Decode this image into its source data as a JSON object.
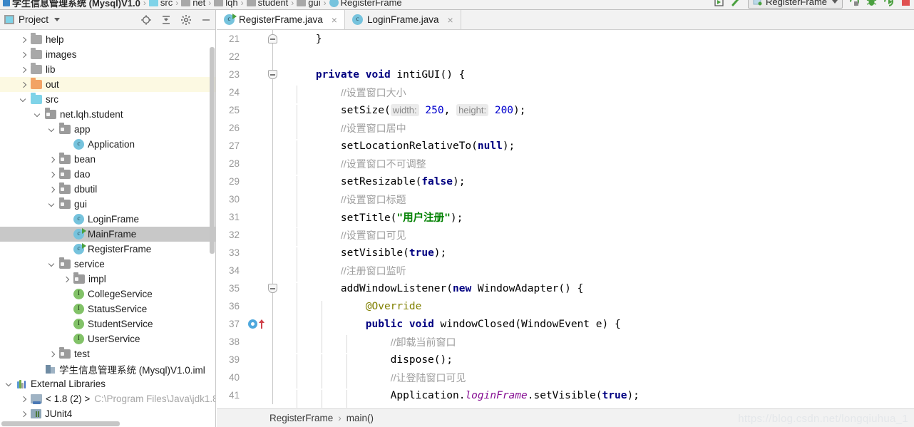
{
  "breadcrumb_top": {
    "items": [
      {
        "label": "学生信息管理系统 (Mysql)V1.0",
        "icon": "project-square-icon"
      },
      {
        "label": "src",
        "icon": "folder-blue-icon"
      },
      {
        "label": "net",
        "icon": "folder-icon"
      },
      {
        "label": "lqh",
        "icon": "folder-icon"
      },
      {
        "label": "student",
        "icon": "folder-icon"
      },
      {
        "label": "gui",
        "icon": "folder-icon"
      },
      {
        "label": "RegisterFrame",
        "icon": "class-icon"
      }
    ],
    "separator": "›"
  },
  "toolbar": {
    "run_config_label": "RegisterFrame",
    "buttons": [
      "project-structure-icon",
      "search-icon",
      "run-config-selector",
      "run-with-coverage-icon",
      "debug-icon",
      "run-icon",
      "stop-icon"
    ]
  },
  "project_panel": {
    "title": "Project",
    "tools": [
      "locate-icon",
      "collapse-all-icon",
      "settings-gear-icon",
      "hide-icon"
    ],
    "tree": [
      {
        "indent": 1,
        "arrow": "right",
        "icon": "folder",
        "label": "help",
        "state": ""
      },
      {
        "indent": 1,
        "arrow": "right",
        "icon": "folder",
        "label": "images",
        "state": ""
      },
      {
        "indent": 1,
        "arrow": "right",
        "icon": "folder",
        "label": "lib",
        "state": ""
      },
      {
        "indent": 1,
        "arrow": "right",
        "icon": "folder-orange",
        "label": "out",
        "state": "highlight"
      },
      {
        "indent": 1,
        "arrow": "down",
        "icon": "folder-blue",
        "label": "src",
        "state": ""
      },
      {
        "indent": 2,
        "arrow": "down",
        "icon": "package",
        "label": "net.lqh.student",
        "state": ""
      },
      {
        "indent": 3,
        "arrow": "down",
        "icon": "package",
        "label": "app",
        "state": ""
      },
      {
        "indent": 4,
        "arrow": "none",
        "icon": "class",
        "label": "Application",
        "state": ""
      },
      {
        "indent": 3,
        "arrow": "right",
        "icon": "package",
        "label": "bean",
        "state": ""
      },
      {
        "indent": 3,
        "arrow": "right",
        "icon": "package",
        "label": "dao",
        "state": ""
      },
      {
        "indent": 3,
        "arrow": "right",
        "icon": "package",
        "label": "dbutil",
        "state": ""
      },
      {
        "indent": 3,
        "arrow": "down",
        "icon": "package",
        "label": "gui",
        "state": ""
      },
      {
        "indent": 4,
        "arrow": "none",
        "icon": "class",
        "label": "LoginFrame",
        "state": ""
      },
      {
        "indent": 4,
        "arrow": "none",
        "icon": "class-runnable",
        "label": "MainFrame",
        "state": "selected"
      },
      {
        "indent": 4,
        "arrow": "none",
        "icon": "class-runnable",
        "label": "RegisterFrame",
        "state": ""
      },
      {
        "indent": 3,
        "arrow": "down",
        "icon": "package",
        "label": "service",
        "state": ""
      },
      {
        "indent": 4,
        "arrow": "right",
        "icon": "package",
        "label": "impl",
        "state": ""
      },
      {
        "indent": 4,
        "arrow": "none",
        "icon": "interface",
        "label": "CollegeService",
        "state": ""
      },
      {
        "indent": 4,
        "arrow": "none",
        "icon": "interface",
        "label": "StatusService",
        "state": ""
      },
      {
        "indent": 4,
        "arrow": "none",
        "icon": "interface",
        "label": "StudentService",
        "state": ""
      },
      {
        "indent": 4,
        "arrow": "none",
        "icon": "interface",
        "label": "UserService",
        "state": ""
      },
      {
        "indent": 3,
        "arrow": "right",
        "icon": "package",
        "label": "test",
        "state": ""
      },
      {
        "indent": 2,
        "arrow": "none",
        "icon": "iml",
        "label": "学生信息管理系统 (Mysql)V1.0.iml",
        "state": ""
      },
      {
        "indent": 0,
        "arrow": "down",
        "icon": "libraries",
        "label": "External Libraries",
        "state": ""
      },
      {
        "indent": 1,
        "arrow": "right",
        "icon": "sdk",
        "label": "< 1.8 (2) >",
        "path": "C:\\Program Files\\Java\\jdk1.8.",
        "state": ""
      },
      {
        "indent": 1,
        "arrow": "right",
        "icon": "jar",
        "label": "JUnit4",
        "state": ""
      }
    ]
  },
  "editor": {
    "tabs": [
      {
        "label": "RegisterFrame.java",
        "icon": "class-runnable-icon",
        "active": true,
        "close": "×"
      },
      {
        "label": "LoginFrame.java",
        "icon": "class-icon",
        "active": false,
        "close": "×"
      }
    ],
    "lines": [
      {
        "num": "21",
        "fold": "end",
        "indent_guides": 0,
        "tokens": [
          {
            "t": "plain",
            "v": "    }"
          }
        ]
      },
      {
        "num": "22",
        "fold": "",
        "indent_guides": 0,
        "tokens": []
      },
      {
        "num": "23",
        "fold": "start",
        "indent_guides": 0,
        "tokens": [
          {
            "t": "plain",
            "v": "    "
          },
          {
            "t": "kw",
            "v": "private void"
          },
          {
            "t": "plain",
            "v": " intiGUI() {"
          }
        ]
      },
      {
        "num": "24",
        "fold": "",
        "indent_guides": 1,
        "tokens": [
          {
            "t": "plain",
            "v": "        "
          },
          {
            "t": "cmt",
            "v": "//设置窗口大小"
          }
        ]
      },
      {
        "num": "25",
        "fold": "",
        "indent_guides": 1,
        "tokens": [
          {
            "t": "plain",
            "v": "        setSize("
          },
          {
            "t": "hint",
            "v": "width:"
          },
          {
            "t": "plain",
            "v": " "
          },
          {
            "t": "num",
            "v": "250"
          },
          {
            "t": "plain",
            "v": ", "
          },
          {
            "t": "hint",
            "v": "height:"
          },
          {
            "t": "plain",
            "v": " "
          },
          {
            "t": "num",
            "v": "200"
          },
          {
            "t": "plain",
            "v": ");"
          }
        ]
      },
      {
        "num": "26",
        "fold": "",
        "indent_guides": 1,
        "tokens": [
          {
            "t": "plain",
            "v": "        "
          },
          {
            "t": "cmt",
            "v": "//设置窗口居中"
          }
        ]
      },
      {
        "num": "27",
        "fold": "",
        "indent_guides": 1,
        "tokens": [
          {
            "t": "plain",
            "v": "        setLocationRelativeTo("
          },
          {
            "t": "kw",
            "v": "null"
          },
          {
            "t": "plain",
            "v": ");"
          }
        ]
      },
      {
        "num": "28",
        "fold": "",
        "indent_guides": 1,
        "tokens": [
          {
            "t": "plain",
            "v": "        "
          },
          {
            "t": "cmt",
            "v": "//设置窗口不可调整"
          }
        ]
      },
      {
        "num": "29",
        "fold": "",
        "indent_guides": 1,
        "tokens": [
          {
            "t": "plain",
            "v": "        setResizable("
          },
          {
            "t": "kw",
            "v": "false"
          },
          {
            "t": "plain",
            "v": ");"
          }
        ]
      },
      {
        "num": "30",
        "fold": "",
        "indent_guides": 1,
        "tokens": [
          {
            "t": "plain",
            "v": "        "
          },
          {
            "t": "cmt",
            "v": "//设置窗口标题"
          }
        ]
      },
      {
        "num": "31",
        "fold": "",
        "indent_guides": 1,
        "tokens": [
          {
            "t": "plain",
            "v": "        setTitle("
          },
          {
            "t": "str",
            "v": "\"用户注册\""
          },
          {
            "t": "plain",
            "v": ");"
          }
        ]
      },
      {
        "num": "32",
        "fold": "",
        "indent_guides": 1,
        "tokens": [
          {
            "t": "plain",
            "v": "        "
          },
          {
            "t": "cmt",
            "v": "//设置窗口可见"
          }
        ]
      },
      {
        "num": "33",
        "fold": "",
        "indent_guides": 1,
        "tokens": [
          {
            "t": "plain",
            "v": "        setVisible("
          },
          {
            "t": "kw",
            "v": "true"
          },
          {
            "t": "plain",
            "v": ");"
          }
        ]
      },
      {
        "num": "34",
        "fold": "",
        "indent_guides": 1,
        "tokens": [
          {
            "t": "plain",
            "v": "        "
          },
          {
            "t": "cmt",
            "v": "//注册窗口监听"
          }
        ]
      },
      {
        "num": "35",
        "fold": "start",
        "indent_guides": 1,
        "tokens": [
          {
            "t": "plain",
            "v": "        addWindowListener("
          },
          {
            "t": "kw",
            "v": "new"
          },
          {
            "t": "plain",
            "v": " WindowAdapter() {"
          }
        ]
      },
      {
        "num": "36",
        "fold": "",
        "indent_guides": 2,
        "tokens": [
          {
            "t": "plain",
            "v": "            "
          },
          {
            "t": "anno",
            "v": "@Override"
          }
        ]
      },
      {
        "num": "37",
        "fold": "",
        "gutter_mark": "overrides-method-icon",
        "indent_guides": 2,
        "tokens": [
          {
            "t": "plain",
            "v": "            "
          },
          {
            "t": "kw",
            "v": "public void"
          },
          {
            "t": "plain",
            "v": " windowClosed(WindowEvent e) {"
          }
        ]
      },
      {
        "num": "38",
        "fold": "",
        "indent_guides": 3,
        "tokens": [
          {
            "t": "plain",
            "v": "                "
          },
          {
            "t": "cmt",
            "v": "//卸载当前窗口"
          }
        ]
      },
      {
        "num": "39",
        "fold": "",
        "indent_guides": 3,
        "tokens": [
          {
            "t": "plain",
            "v": "                dispose();"
          }
        ]
      },
      {
        "num": "40",
        "fold": "",
        "indent_guides": 3,
        "tokens": [
          {
            "t": "plain",
            "v": "                "
          },
          {
            "t": "cmt",
            "v": "//让登陆窗口可见"
          }
        ]
      },
      {
        "num": "41",
        "fold": "",
        "indent_guides": 3,
        "tokens": [
          {
            "t": "plain",
            "v": "                Application."
          },
          {
            "t": "fld",
            "v": "loginFrame"
          },
          {
            "t": "plain",
            "v": ".setVisible("
          },
          {
            "t": "kw",
            "v": "true"
          },
          {
            "t": "plain",
            "v": ");"
          }
        ]
      }
    ],
    "breadcrumb": [
      "RegisterFrame",
      "main()"
    ],
    "breadcrumb_separator": "›"
  },
  "watermark": "https://blog.csdn.net/longqiuhua_1",
  "colors": {
    "accent_blue": "#76c3dd",
    "interface_green": "#82c268",
    "folder_gray": "#a8a8a8",
    "folder_orange": "#f2a365",
    "folder_blue": "#7fd3e8",
    "selection_gray": "#c8c8c8",
    "highlight_yellow": "#fcf9e2",
    "keyword": "#000080",
    "string": "#008000",
    "comment": "#9e9e9e",
    "number": "#0000cd",
    "annotation": "#808000",
    "static_field": "#871094"
  }
}
